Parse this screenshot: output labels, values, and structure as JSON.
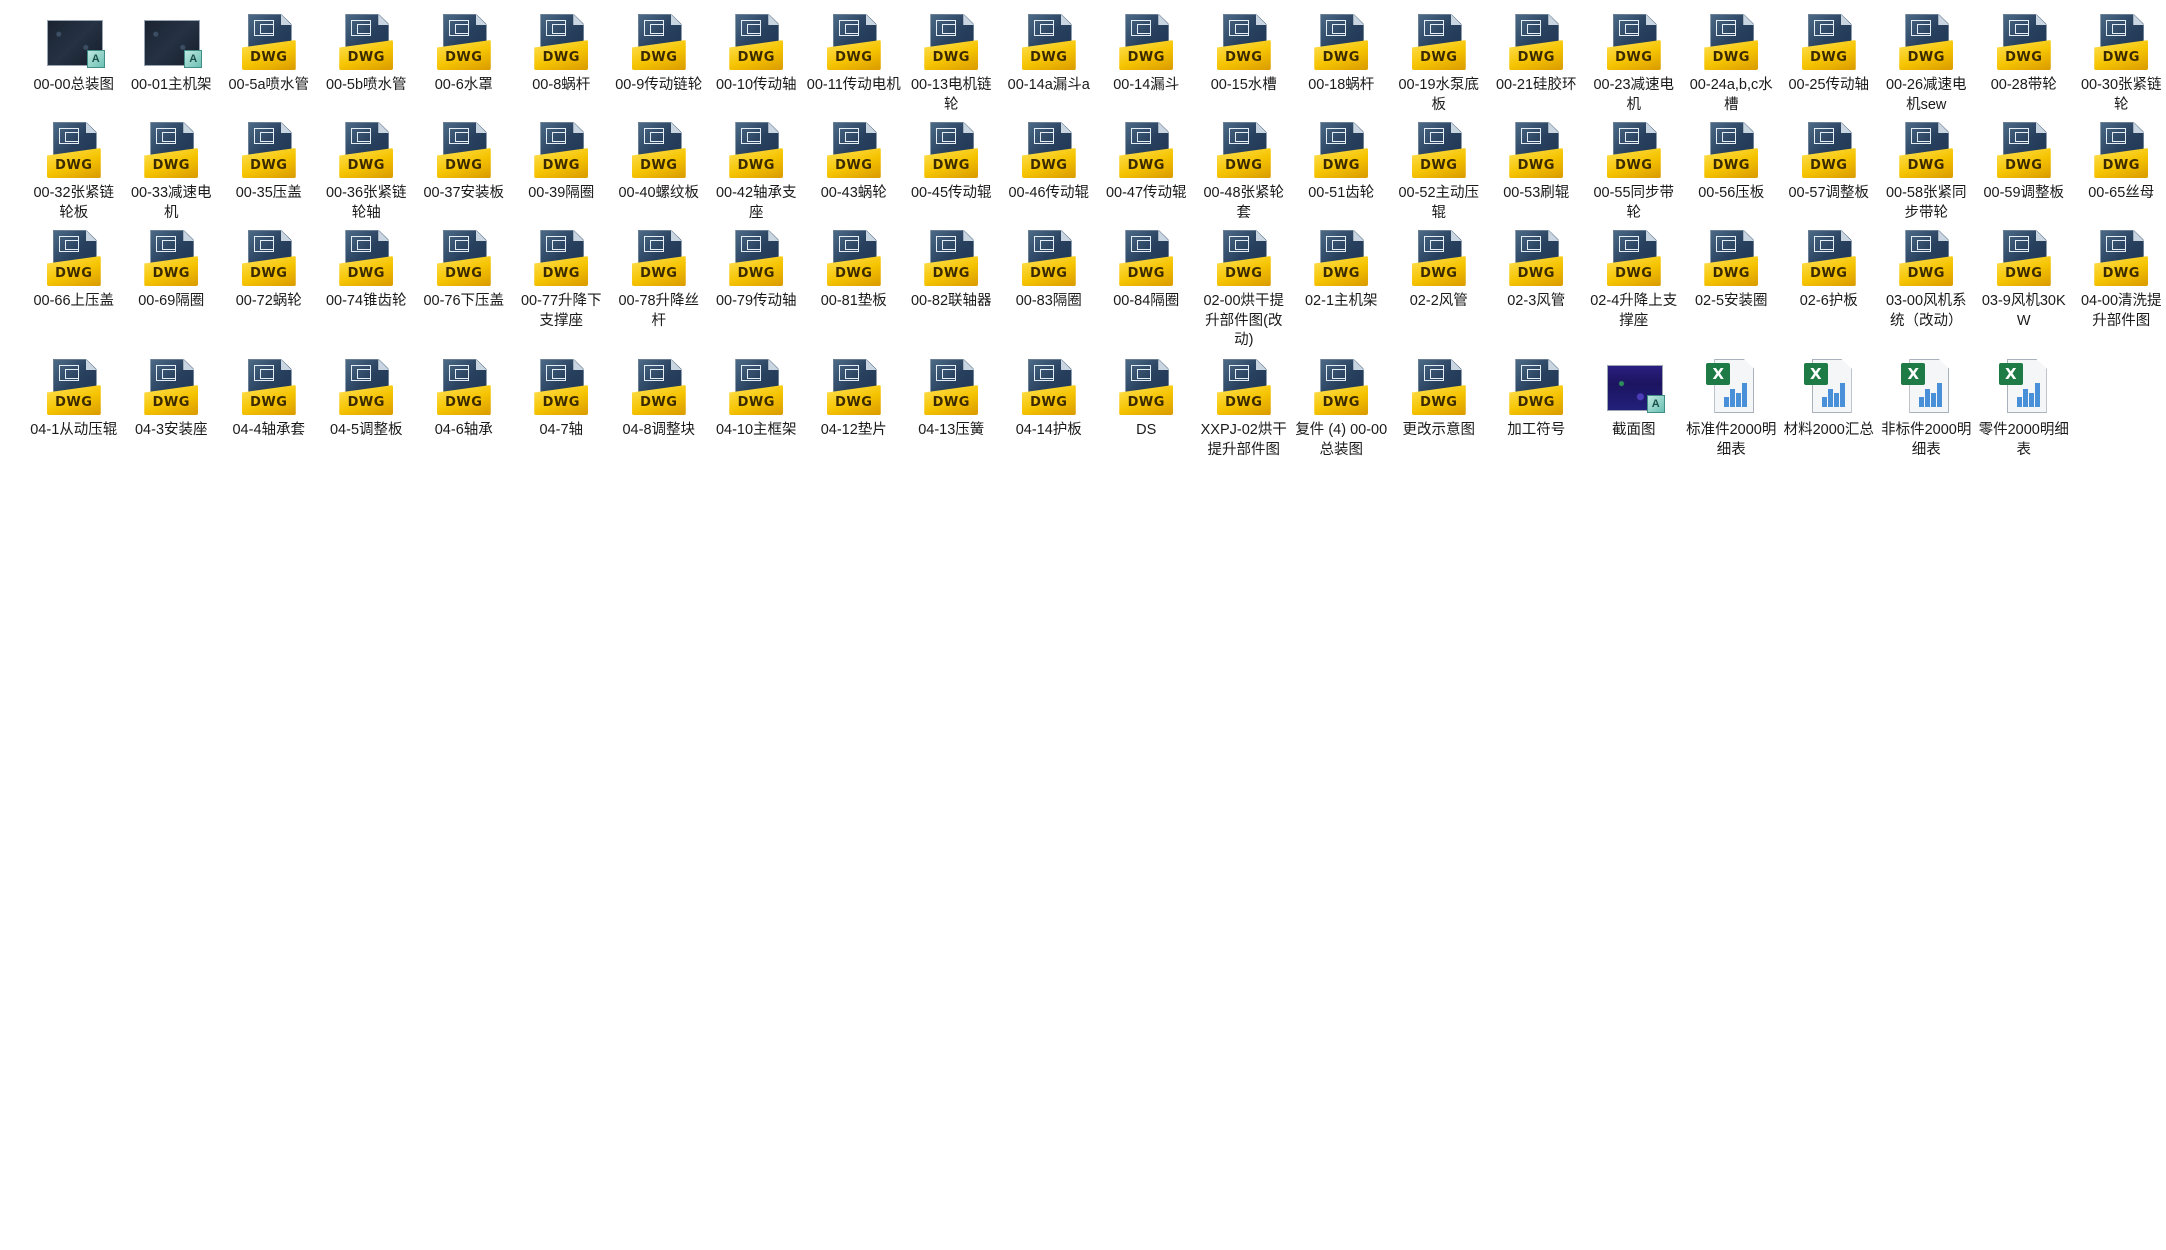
{
  "rows": [
    {
      "row_class": "row1",
      "files": [
        {
          "label": "00-00总装图",
          "type": "image-icon"
        },
        {
          "label": "00-01主机架",
          "type": "image-icon"
        },
        {
          "label": "00-5a喷水管",
          "type": "dwg-icon"
        },
        {
          "label": "00-5b喷水管",
          "type": "dwg-icon"
        },
        {
          "label": "00-6水罩",
          "type": "dwg-icon"
        },
        {
          "label": "00-8蜗杆",
          "type": "dwg-icon"
        },
        {
          "label": "00-9传动链轮",
          "type": "dwg-icon"
        },
        {
          "label": "00-10传动轴",
          "type": "dwg-icon"
        },
        {
          "label": "00-11传动电机",
          "type": "dwg-icon"
        },
        {
          "label": "00-13电机链轮",
          "type": "dwg-icon"
        },
        {
          "label": "00-14a漏斗a",
          "type": "dwg-icon"
        },
        {
          "label": "00-14漏斗",
          "type": "dwg-icon"
        },
        {
          "label": "00-15水槽",
          "type": "dwg-icon"
        },
        {
          "label": "00-18蜗杆",
          "type": "dwg-icon"
        },
        {
          "label": "00-19水泵底板",
          "type": "dwg-icon"
        },
        {
          "label": "00-21硅胶环",
          "type": "dwg-icon"
        },
        {
          "label": "00-23减速电机",
          "type": "dwg-icon"
        },
        {
          "label": "00-24a,b,c水槽",
          "type": "dwg-icon"
        },
        {
          "label": "00-25传动轴",
          "type": "dwg-icon"
        },
        {
          "label": "00-26减速电机sew",
          "type": "dwg-icon"
        },
        {
          "label": "00-28带轮",
          "type": "dwg-icon"
        },
        {
          "label": "00-30张紧链轮",
          "type": "dwg-icon"
        }
      ]
    },
    {
      "row_class": "row2",
      "files": [
        {
          "label": "00-32张紧链轮板",
          "type": "dwg-icon"
        },
        {
          "label": "00-33减速电机",
          "type": "dwg-icon"
        },
        {
          "label": "00-35压盖",
          "type": "dwg-icon"
        },
        {
          "label": "00-36张紧链轮轴",
          "type": "dwg-icon"
        },
        {
          "label": "00-37安装板",
          "type": "dwg-icon"
        },
        {
          "label": "00-39隔圈",
          "type": "dwg-icon"
        },
        {
          "label": "00-40螺纹板",
          "type": "dwg-icon"
        },
        {
          "label": "00-42轴承支座",
          "type": "dwg-icon"
        },
        {
          "label": "00-43蜗轮",
          "type": "dwg-icon"
        },
        {
          "label": "00-45传动辊",
          "type": "dwg-icon"
        },
        {
          "label": "00-46传动辊",
          "type": "dwg-icon"
        },
        {
          "label": "00-47传动辊",
          "type": "dwg-icon"
        },
        {
          "label": "00-48张紧轮套",
          "type": "dwg-icon"
        },
        {
          "label": "00-51齿轮",
          "type": "dwg-icon"
        },
        {
          "label": "00-52主动压辊",
          "type": "dwg-icon"
        },
        {
          "label": "00-53刷辊",
          "type": "dwg-icon"
        },
        {
          "label": "00-55同步带轮",
          "type": "dwg-icon"
        },
        {
          "label": "00-56压板",
          "type": "dwg-icon"
        },
        {
          "label": "00-57调整板",
          "type": "dwg-icon"
        },
        {
          "label": "00-58张紧同步带轮",
          "type": "dwg-icon"
        },
        {
          "label": "00-59调整板",
          "type": "dwg-icon"
        },
        {
          "label": "00-65丝母",
          "type": "dwg-icon"
        }
      ]
    },
    {
      "row_class": "row3",
      "files": [
        {
          "label": "00-66上压盖",
          "type": "dwg-icon"
        },
        {
          "label": "00-69隔圈",
          "type": "dwg-icon"
        },
        {
          "label": "00-72蜗轮",
          "type": "dwg-icon"
        },
        {
          "label": "00-74锥齿轮",
          "type": "dwg-icon"
        },
        {
          "label": "00-76下压盖",
          "type": "dwg-icon"
        },
        {
          "label": "00-77升降下支撑座",
          "type": "dwg-icon"
        },
        {
          "label": "00-78升降丝杆",
          "type": "dwg-icon"
        },
        {
          "label": "00-79传动轴",
          "type": "dwg-icon"
        },
        {
          "label": "00-81垫板",
          "type": "dwg-icon"
        },
        {
          "label": "00-82联轴器",
          "type": "dwg-icon"
        },
        {
          "label": "00-83隔圈",
          "type": "dwg-icon"
        },
        {
          "label": "00-84隔圈",
          "type": "dwg-icon"
        },
        {
          "label": "02-00烘干提升部件图(改动)",
          "type": "dwg-icon"
        },
        {
          "label": "02-1主机架",
          "type": "dwg-icon"
        },
        {
          "label": "02-2风管",
          "type": "dwg-icon"
        },
        {
          "label": "02-3风管",
          "type": "dwg-icon"
        },
        {
          "label": "02-4升降上支撑座",
          "type": "dwg-icon"
        },
        {
          "label": "02-5安装圈",
          "type": "dwg-icon"
        },
        {
          "label": "02-6护板",
          "type": "dwg-icon"
        },
        {
          "label": "03-00风机系统（改动）",
          "type": "dwg-icon"
        },
        {
          "label": "03-9风机30KW",
          "type": "dwg-icon"
        },
        {
          "label": "04-00清洗提升部件图",
          "type": "dwg-icon"
        }
      ]
    },
    {
      "row_class": "row4",
      "files": [
        {
          "label": "04-1从动压辊",
          "type": "dwg-icon"
        },
        {
          "label": "04-3安装座",
          "type": "dwg-icon"
        },
        {
          "label": "04-4轴承套",
          "type": "dwg-icon"
        },
        {
          "label": "04-5调整板",
          "type": "dwg-icon"
        },
        {
          "label": "04-6轴承",
          "type": "dwg-icon"
        },
        {
          "label": "04-7轴",
          "type": "dwg-icon"
        },
        {
          "label": "04-8调整块",
          "type": "dwg-icon"
        },
        {
          "label": "04-10主框架",
          "type": "dwg-icon"
        },
        {
          "label": "04-12垫片",
          "type": "dwg-icon"
        },
        {
          "label": "04-13压簧",
          "type": "dwg-icon"
        },
        {
          "label": "04-14护板",
          "type": "dwg-icon"
        },
        {
          "label": "DS",
          "type": "dwg-icon"
        },
        {
          "label": "XXPJ-02烘干提升部件图",
          "type": "dwg-icon"
        },
        {
          "label": "复件 (4) 00-00总装图",
          "type": "dwg-icon"
        },
        {
          "label": "更改示意图",
          "type": "dwg-icon"
        },
        {
          "label": "加工符号",
          "type": "dwg-icon"
        },
        {
          "label": "截面图",
          "type": "image-icon-purple"
        },
        {
          "label": "标准件2000明细表",
          "type": "excel-icon"
        },
        {
          "label": "材料2000汇总",
          "type": "excel-icon"
        },
        {
          "label": "非标件2000明细表",
          "type": "excel-icon"
        },
        {
          "label": "零件2000明细表",
          "type": "excel-icon"
        }
      ]
    }
  ],
  "icons": {
    "dwg_tag": "DWG",
    "image_badge": "A",
    "excel_mark": "X"
  },
  "colors": {
    "dwg_blue": "#28415f",
    "dwg_yellow": "#f5c300",
    "excel_green": "#1e7b45",
    "chart_blue": "#4a90d9"
  }
}
